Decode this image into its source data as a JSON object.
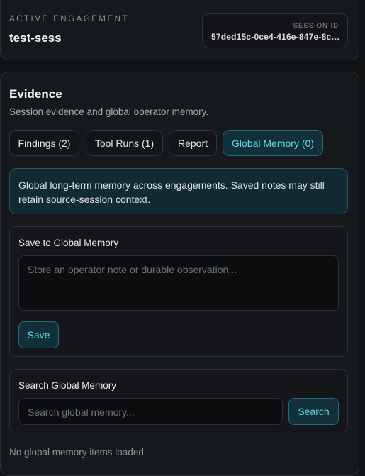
{
  "engagement": {
    "label": "ACTIVE ENGAGEMENT",
    "name": "test-sess",
    "session_label": "SESSION ID",
    "session_id": "57ded15c-0ce4-416e-847e-8cd..."
  },
  "evidence": {
    "title": "Evidence",
    "subtitle": "Session evidence and global operator memory.",
    "tabs": [
      {
        "label": "Findings (2)",
        "active": false
      },
      {
        "label": "Tool Runs (1)",
        "active": false
      },
      {
        "label": "Report",
        "active": false
      },
      {
        "label": "Global Memory (0)",
        "active": true
      }
    ],
    "info": "Global long-term memory across engagements. Saved notes may still retain source-session context.",
    "save_section": {
      "title": "Save to Global Memory",
      "placeholder": "Store an operator note or durable observation...",
      "button": "Save"
    },
    "search_section": {
      "title": "Search Global Memory",
      "placeholder": "Search global memory...",
      "button": "Search"
    },
    "empty_message": "No global memory items loaded."
  },
  "colors": {
    "accent": "#67d7ea",
    "accent_bg": "#123039",
    "background": "#101214",
    "panel": "#16191c"
  }
}
